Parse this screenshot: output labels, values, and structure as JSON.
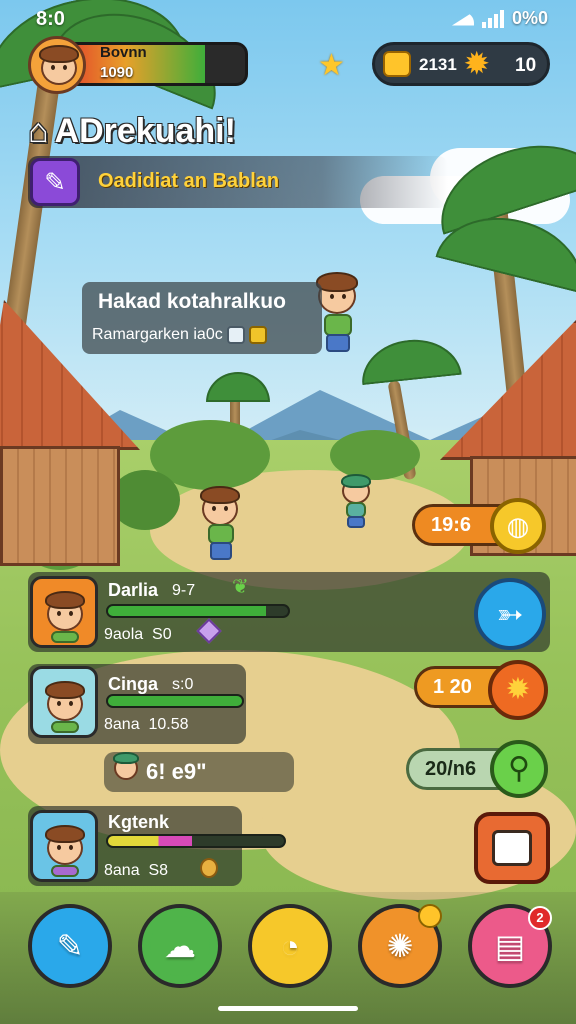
{
  "status_bar": {
    "time": "8:0",
    "battery": "0%0"
  },
  "profile": {
    "name": "Bovnn",
    "points": "1090",
    "energy_fraction": 0.78
  },
  "currency": {
    "gold": "2131",
    "gears": "10"
  },
  "title": "ADrekuahi!",
  "quest_banner": "Oadidiat an Bablan",
  "npc_bubble": {
    "line1": "Hakad kotahralkuo",
    "line2": "Ramargarken ia0c"
  },
  "party": [
    {
      "name": "Darlia",
      "value": "9-7",
      "stat_label": "9aola",
      "stat_value": "S0",
      "hp_fraction": 0.88,
      "hp_color": "#3fae3a",
      "portrait_color": "#f08a28"
    },
    {
      "name": "Cinga",
      "value": "s:0",
      "stat_label": "8ana",
      "stat_value": "10.58",
      "hp_fraction": 1.0,
      "hp_color": "#3fae3a",
      "portrait_color": "#9adbe4"
    },
    {
      "name": "Kgtenk",
      "value": "",
      "stat_label": "8ana",
      "stat_value": "S8",
      "hp_fraction": 0.48,
      "hp_color": "#e2d83a",
      "hp_color2": "#d84ab8",
      "portrait_color": "#6ac4e6"
    }
  ],
  "emote_text": "6! e9\"",
  "right_widgets": {
    "timer_pill": "19:6",
    "energy_pill": "1 20",
    "range_pill": "20/n6"
  },
  "dock": {
    "buttons": [
      {
        "icon": "pencil-icon",
        "color": "#2aa8ea"
      },
      {
        "icon": "cloud-icon",
        "color": "#4fb44a"
      },
      {
        "icon": "chat-icon",
        "color": "#f6c82a"
      },
      {
        "icon": "burst-icon",
        "color": "#f0922a"
      },
      {
        "icon": "inventory-icon",
        "color": "#ec5a8a"
      }
    ],
    "badge_count": "2"
  }
}
